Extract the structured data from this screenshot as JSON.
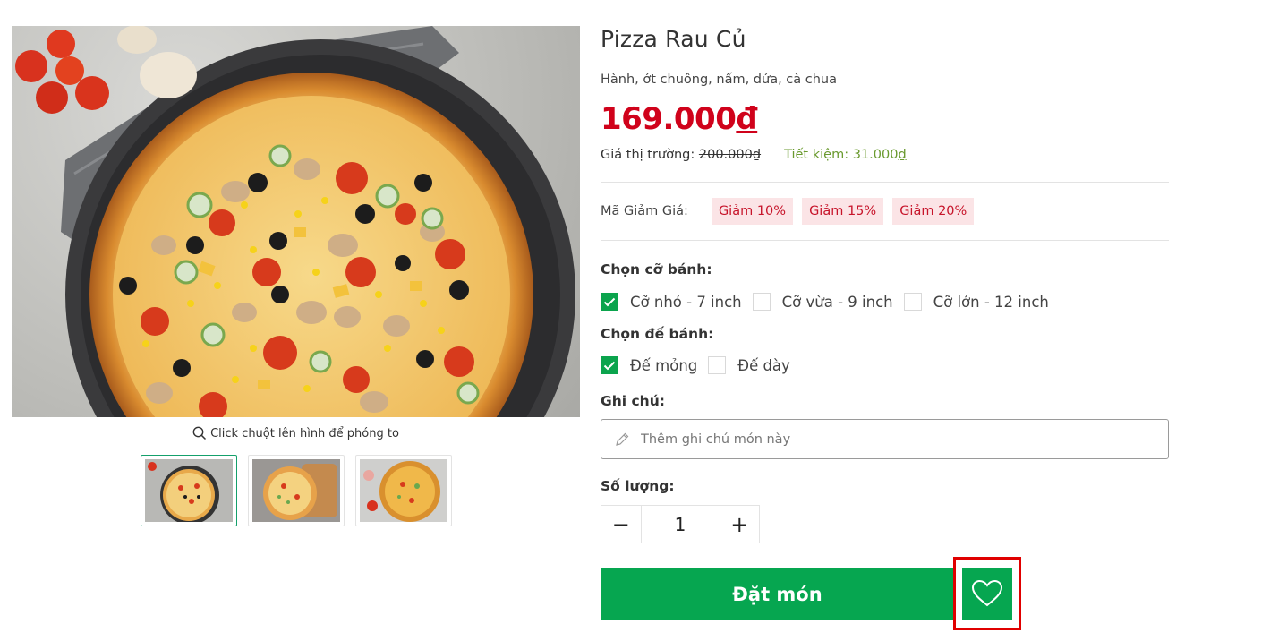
{
  "gallery": {
    "zoom_hint": "Click chuột lên hình để phóng to",
    "thumbnails": [
      "pizza-top-view",
      "pizza-slices-board",
      "pizza-with-toppings"
    ]
  },
  "product": {
    "title": "Pizza Rau Củ",
    "description": "Hành, ớt chuông, nấm, dứa, cà chua",
    "price_number": "169.000",
    "price_currency": "đ",
    "market_label": "Giá thị trường:",
    "market_price": "200.000₫",
    "saving_label": "Tiết kiệm:",
    "saving_number": "31.000",
    "saving_currency": "₫"
  },
  "coupons": {
    "label": "Mã Giảm Giá:",
    "items": [
      "Giảm 10%",
      "Giảm 15%",
      "Giảm 20%"
    ]
  },
  "size": {
    "label": "Chọn cỡ bánh:",
    "options": [
      {
        "label": "Cỡ nhỏ - 7 inch",
        "checked": true
      },
      {
        "label": "Cỡ vừa - 9 inch",
        "checked": false
      },
      {
        "label": "Cỡ lớn - 12 inch",
        "checked": false
      }
    ]
  },
  "crust": {
    "label": "Chọn đế bánh:",
    "options": [
      {
        "label": "Đế mỏng",
        "checked": true
      },
      {
        "label": "Đế dày",
        "checked": false
      }
    ]
  },
  "note": {
    "label": "Ghi chú:",
    "placeholder": "Thêm ghi chú món này",
    "value": ""
  },
  "quantity": {
    "label": "Số lượng:",
    "value": "1",
    "minus": "−",
    "plus": "+"
  },
  "actions": {
    "order_label": "Đặt món"
  },
  "colors": {
    "primary_green": "#06a650",
    "price_red": "#d0021b",
    "highlight_red": "#e00000"
  }
}
